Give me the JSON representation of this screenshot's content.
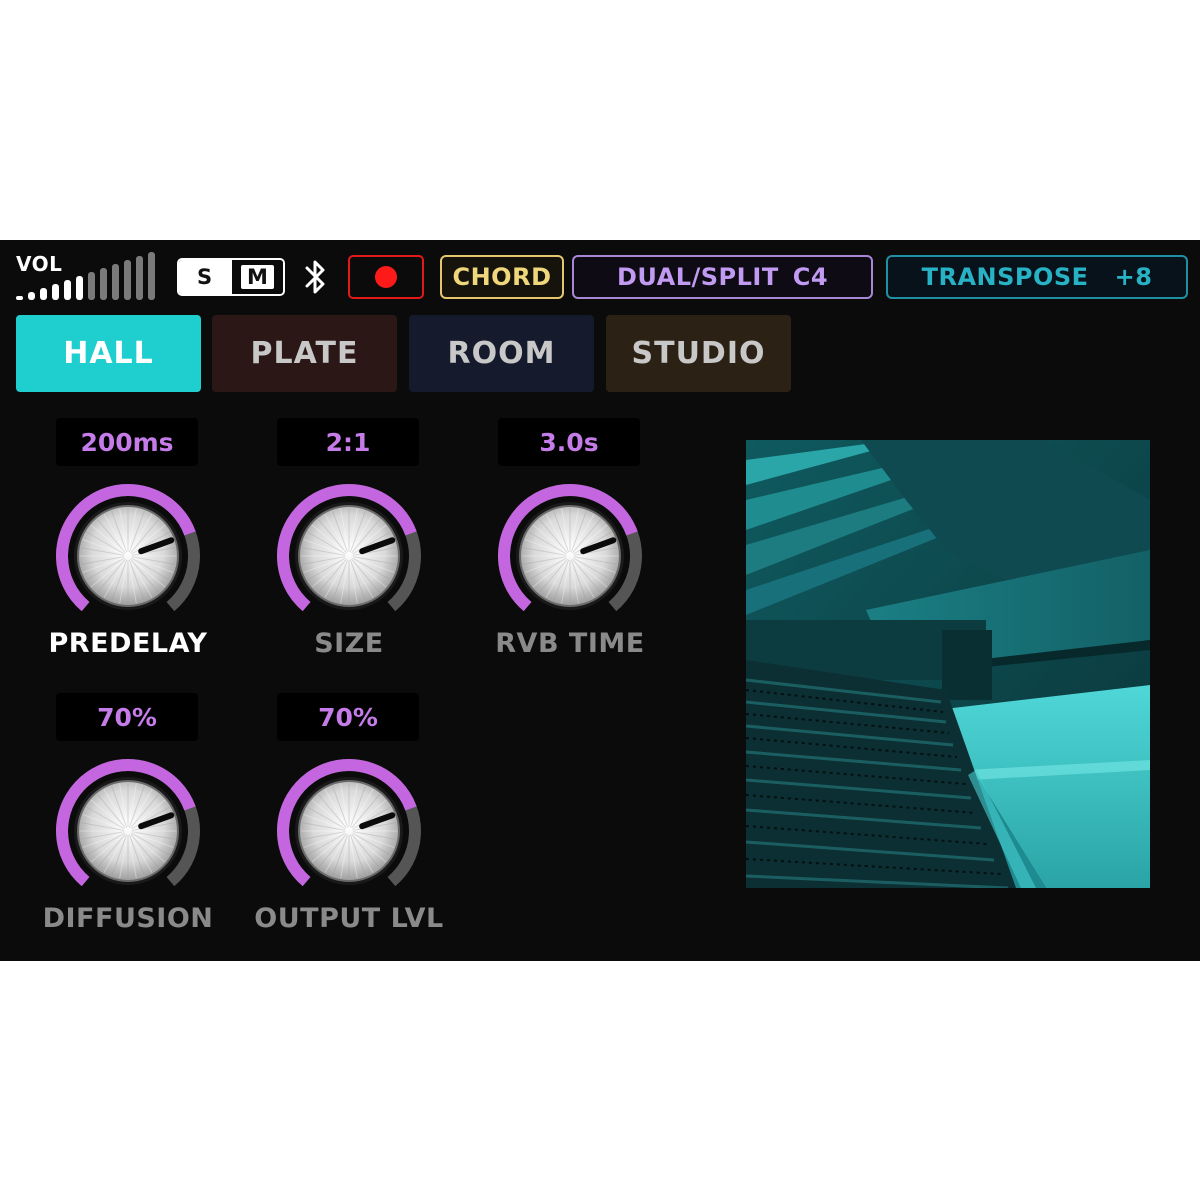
{
  "topbar": {
    "vol_label": "VOL",
    "vol_level": 0.5,
    "vol_bars_total": 12,
    "solo_label": "S",
    "mono_label": "M",
    "bluetooth_icon": "bluetooth-icon",
    "record_icon": "record-dot-icon",
    "chord_label": "CHORD",
    "dual_split_label": "DUAL/SPLIT",
    "dual_split_value": "C4",
    "transpose_label": "TRANSPOSE",
    "transpose_value": "+8"
  },
  "tabs": [
    {
      "label": "HALL",
      "active": true
    },
    {
      "label": "PLATE",
      "active": false
    },
    {
      "label": "ROOM",
      "active": false
    },
    {
      "label": "STUDIO",
      "active": false
    }
  ],
  "knobs": [
    {
      "label": "PREDELAY",
      "value": "200ms",
      "level": 0.75,
      "active": true
    },
    {
      "label": "SIZE",
      "value": "2:1",
      "level": 0.75,
      "active": false
    },
    {
      "label": "RVB TIME",
      "value": "3.0s",
      "level": 0.75,
      "active": false
    },
    {
      "label": "DIFFUSION",
      "value": "70%",
      "level": 0.75,
      "active": false
    },
    {
      "label": "OUTPUT LVL",
      "value": "70%",
      "level": 0.75,
      "active": false
    }
  ],
  "colors": {
    "accent_cyan": "#1fcfcf",
    "knob_arc": "#c466e0",
    "knob_track": "#555555",
    "chord": "#f0d77c",
    "dual_split": "#c19af1",
    "transpose": "#28b2c5",
    "record": "#ff1a1a"
  },
  "preview_image": "concert-hall-photo"
}
